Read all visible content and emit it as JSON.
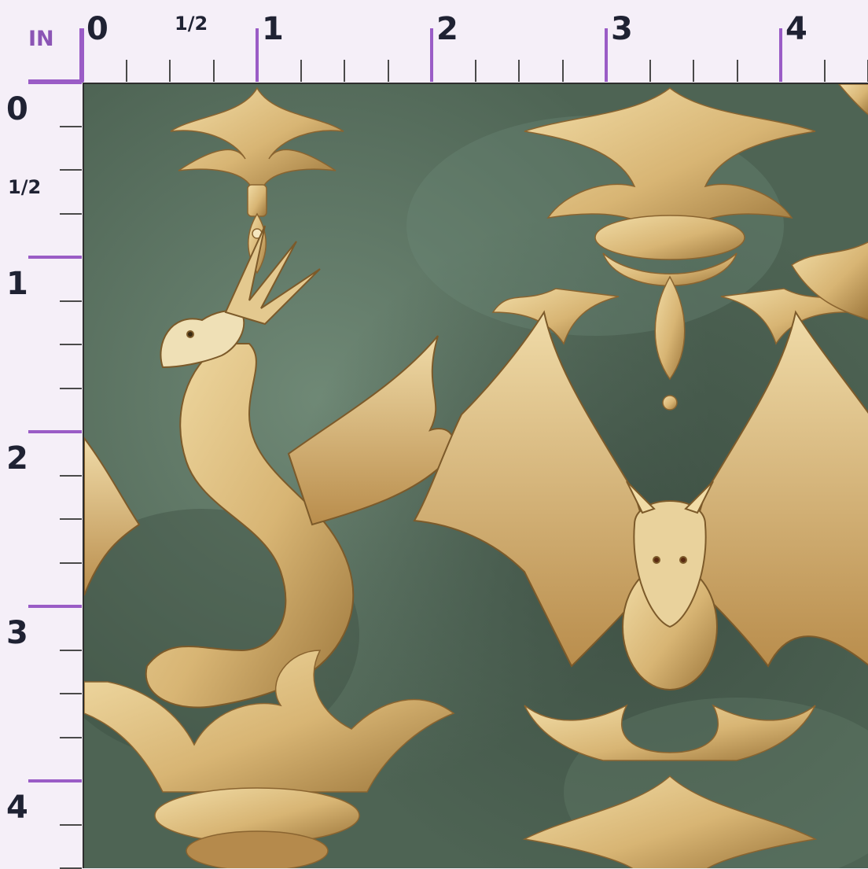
{
  "ruler": {
    "unit": "IN",
    "top_labels": [
      "0",
      "1/2",
      "1",
      "2",
      "3",
      "4"
    ],
    "left_labels": [
      "0",
      "1/2",
      "1",
      "2",
      "3",
      "4"
    ]
  },
  "pattern": {
    "motif": "gold dragons and baroque damask on mottled green",
    "colors": {
      "background": "#4e6454",
      "gold": "#d8b574",
      "gold_dark": "#a07a3e",
      "cream": "#efe0b6",
      "ruler_accent": "#9a5cc6"
    }
  }
}
